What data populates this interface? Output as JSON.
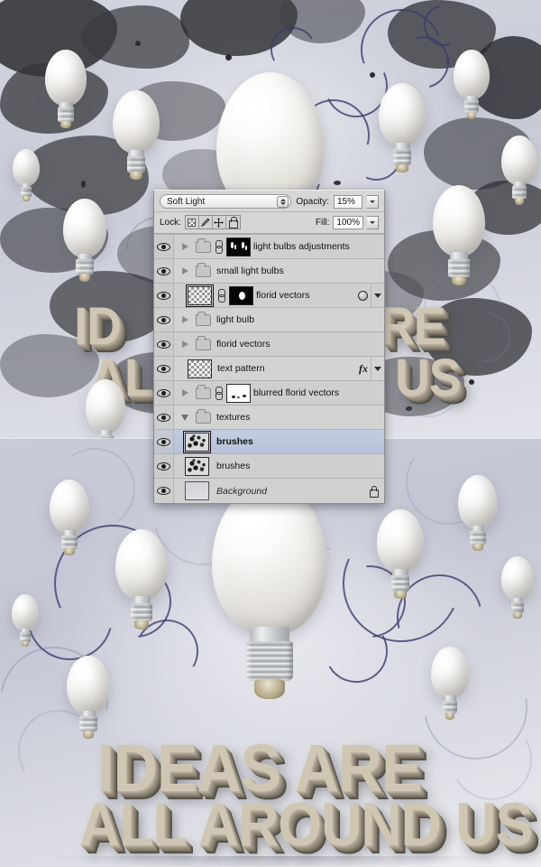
{
  "artwork": {
    "headline_line1": "IDEAS ARE",
    "headline_line2": "ALL AROUND US",
    "top_fragment_left_line1": "ID",
    "top_fragment_left_line2": "ALL",
    "top_fragment_right_line1": "RE",
    "top_fragment_right_line2": "US"
  },
  "panel": {
    "name": "layers-panel",
    "blend_mode": "Soft Light",
    "opacity_label": "Opacity:",
    "opacity_value": "15%",
    "lock_label": "Lock:",
    "fill_label": "Fill:",
    "fill_value": "100%",
    "lock_buttons": [
      "lock-transparent-pixels",
      "lock-image-pixels",
      "lock-position",
      "lock-all"
    ],
    "layers": [
      {
        "name": "light bulbs adjustments",
        "type": "group",
        "visible": true,
        "expanded": false,
        "has_mask": true,
        "mask_kind": "bulbs",
        "linked": true,
        "selected": false,
        "fx": false,
        "mask_icon": false
      },
      {
        "name": "small light bulbs",
        "type": "group",
        "visible": true,
        "expanded": false,
        "has_mask": false,
        "mask_kind": "",
        "linked": false,
        "selected": false,
        "fx": false,
        "mask_icon": false
      },
      {
        "name": "florid vectors",
        "type": "layer",
        "visible": true,
        "expanded": false,
        "has_mask": true,
        "mask_kind": "dot",
        "linked": true,
        "selected": false,
        "fx": false,
        "mask_icon": true
      },
      {
        "name": "light bulb",
        "type": "group",
        "visible": true,
        "expanded": false,
        "has_mask": false,
        "mask_kind": "",
        "linked": false,
        "selected": false,
        "fx": false,
        "mask_icon": false
      },
      {
        "name": "florid vectors",
        "type": "group",
        "visible": true,
        "expanded": false,
        "has_mask": false,
        "mask_kind": "",
        "linked": false,
        "selected": false,
        "fx": false,
        "mask_icon": false
      },
      {
        "name": "text pattern",
        "type": "layer",
        "visible": true,
        "expanded": false,
        "has_mask": false,
        "mask_kind": "",
        "linked": false,
        "selected": false,
        "fx": true,
        "mask_icon": false
      },
      {
        "name": "blurred florid vectors",
        "type": "group",
        "visible": true,
        "expanded": false,
        "has_mask": true,
        "mask_kind": "specks",
        "linked": true,
        "selected": false,
        "fx": false,
        "mask_icon": false
      },
      {
        "name": "textures",
        "type": "group",
        "visible": true,
        "expanded": true,
        "has_mask": false,
        "mask_kind": "",
        "linked": false,
        "selected": false,
        "fx": false,
        "mask_icon": false
      },
      {
        "name": "brushes",
        "type": "layer",
        "visible": true,
        "expanded": false,
        "has_mask": false,
        "mask_kind": "",
        "linked": false,
        "selected": true,
        "fx": false,
        "mask_icon": false
      },
      {
        "name": "brushes",
        "type": "layer",
        "visible": true,
        "expanded": false,
        "has_mask": false,
        "mask_kind": "",
        "linked": false,
        "selected": false,
        "fx": false,
        "mask_icon": false
      },
      {
        "name": "Background",
        "type": "background",
        "visible": true,
        "expanded": false,
        "has_mask": false,
        "mask_kind": "",
        "linked": false,
        "selected": false,
        "fx": false,
        "mask_icon": false,
        "locked": true
      }
    ]
  },
  "colors": {
    "panel_bg": "#d2d2d2",
    "row_selected": "#c3cde0",
    "text_3d": "#cfc6b3",
    "swirl_ink": "#3a3a6e",
    "splatter": "#2b2b2e"
  }
}
